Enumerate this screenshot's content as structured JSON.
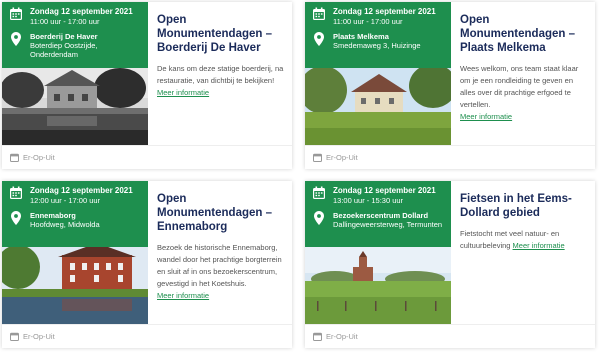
{
  "cards": [
    {
      "date": "Zondag 12 september 2021",
      "time": "11:00 uur - 17:00 uur",
      "place": "Boerderij De Haver",
      "address": "Boterdiep Oostzijde, Onderdendam",
      "title": "Open Monumentendagen – Boerderij De Haver",
      "description": "De kans om deze statige boerderij, na restauratie, van dichtbij te bekijken!",
      "more_label": "Meer informatie",
      "category": "Er-Op-Uit"
    },
    {
      "date": "Zondag 12 september 2021",
      "time": "11:00 uur - 17:00 uur",
      "place": "Plaats Melkema",
      "address": "Smedemaweg 3, Huizinge",
      "title": "Open Monumentendagen – Plaats Melkema",
      "description": "Wees welkom, ons team staat klaar om je een rondleiding te geven en alles over dit prachtige erfgoed te vertellen.",
      "more_label": "Meer informatie",
      "category": "Er-Op-Uit"
    },
    {
      "date": "Zondag 12 september 2021",
      "time": "12:00 uur - 17:00 uur",
      "place": "Ennemaborg",
      "address": "Hoofdweg, Midwolda",
      "title": "Open Monumentendagen – Ennemaborg",
      "description": "Bezoek de historische Ennemaborg, wandel door het prachtige borgterrein en sluit af in ons bezoekerscentrum, gevestigd in het Koetshuis.",
      "more_label": "Meer informatie",
      "category": "Er-Op-Uit"
    },
    {
      "date": "Zondag 12 september 2021",
      "time": "13:00 uur - 15:30 uur",
      "place": "Bezoekerscentrum Dollard",
      "address": "Dallingeweersterweg, Termunten",
      "title": "Fietsen in het Eems-Dollard gebied",
      "description": "Fietstocht met veel natuur- en cultuurbeleving",
      "more_label": "Meer informatie",
      "category": "Er-Op-Uit"
    }
  ],
  "icons": {
    "calendar": "calendar-icon",
    "location": "map-pin-icon",
    "category": "calendar-small-icon"
  },
  "colors": {
    "accent": "#1e8f4e",
    "title": "#1b2b5a"
  }
}
